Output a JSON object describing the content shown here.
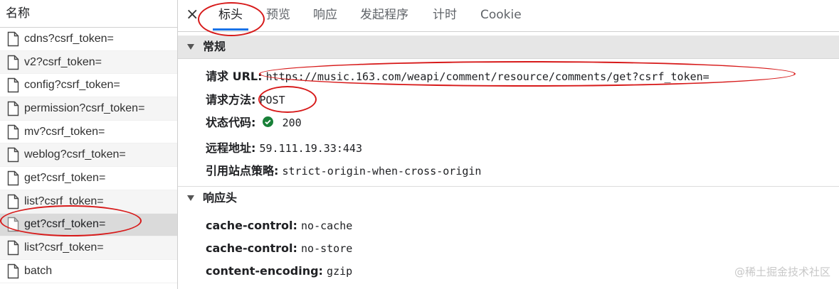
{
  "list": {
    "header": "名称",
    "items": [
      {
        "label": "cdns?csrf_token="
      },
      {
        "label": "v2?csrf_token="
      },
      {
        "label": "config?csrf_token="
      },
      {
        "label": "permission?csrf_token="
      },
      {
        "label": "mv?csrf_token="
      },
      {
        "label": "weblog?csrf_token="
      },
      {
        "label": "get?csrf_token="
      },
      {
        "label": "list?csrf_token="
      },
      {
        "label": "get?csrf_token="
      },
      {
        "label": "list?csrf_token="
      },
      {
        "label": "batch"
      }
    ],
    "selected_index": 8
  },
  "tabs": {
    "close_icon": "×",
    "items": [
      "标头",
      "预览",
      "响应",
      "发起程序",
      "计时",
      "Cookie"
    ],
    "active_index": 0
  },
  "general": {
    "title": "常规",
    "request_url_label": "请求 URL:",
    "request_url": "https://music.163.com/weapi/comment/resource/comments/get?csrf_token=",
    "method_label": "请求方法:",
    "method": "POST",
    "status_label": "状态代码:",
    "status_icon": "check-circle-icon",
    "status": "200",
    "remote_label": "远程地址:",
    "remote": "59.111.19.33:443",
    "referrer_label": "引用站点策略:",
    "referrer": "strict-origin-when-cross-origin"
  },
  "response_headers": {
    "title": "响应头",
    "rows": [
      {
        "key": "cache-control:",
        "value": "no-cache"
      },
      {
        "key": "cache-control:",
        "value": "no-store"
      },
      {
        "key": "content-encoding:",
        "value": "gzip"
      }
    ]
  },
  "colors": {
    "accent": "#1a73e8",
    "annotation": "#d71a1a",
    "status_ok": "#188038"
  },
  "watermark": "@稀土掘金技术社区"
}
